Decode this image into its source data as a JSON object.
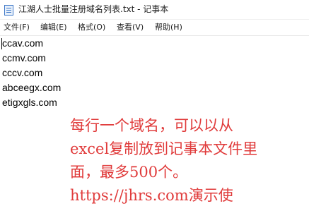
{
  "window": {
    "title": "江湖人士批量注册域名列表.txt - 记事本",
    "icon": "notepad-icon"
  },
  "menu": [
    {
      "label": "文件(F)"
    },
    {
      "label": "编辑(E)"
    },
    {
      "label": "格式(O)"
    },
    {
      "label": "查看(V)"
    },
    {
      "label": "帮助(H)"
    }
  ],
  "document": {
    "lines": [
      "ccav.com",
      "ccmv.com",
      "cccv.com",
      "abceegx.com",
      "etigxgls.com"
    ]
  },
  "annotation": {
    "color": "#e03a3a",
    "lines": [
      "每行一个域名，可以以从",
      "excel复制放到记事本文件里",
      "面，最多500个。",
      "https://jhrs.com演示使"
    ]
  }
}
